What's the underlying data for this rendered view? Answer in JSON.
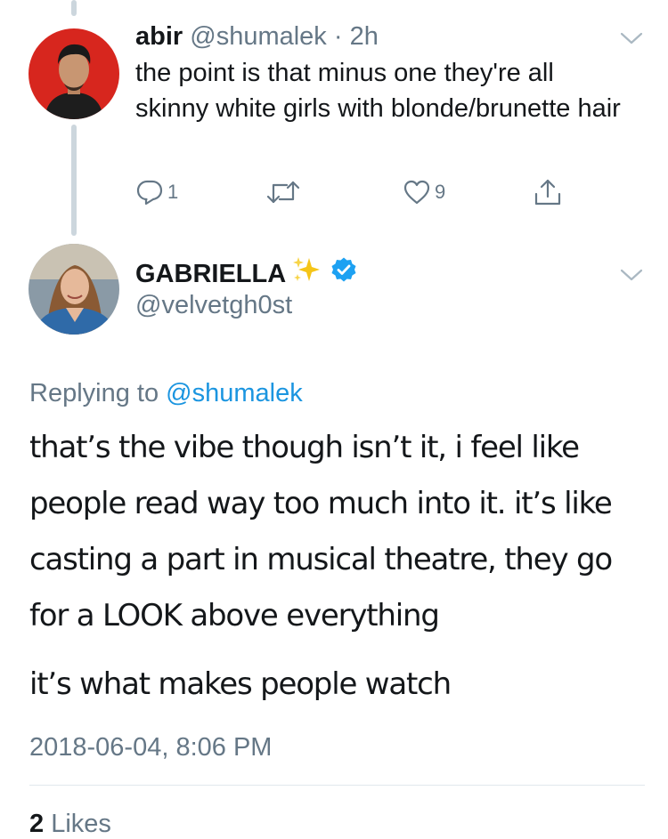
{
  "parent_tweet": {
    "display_name": "abir",
    "handle": "@shumalek",
    "separator": "·",
    "time_ago": "2h",
    "text": "the point is that minus one they're all skinny white girls with blonde/brunette hair",
    "replies": "1",
    "likes": "9",
    "avatar_bg": "#d7261e"
  },
  "main_tweet": {
    "display_name": "GABRIELLA",
    "handle": "@velvetgh0st",
    "replying_prefix": "Replying to",
    "replying_to": "@shumalek",
    "paragraphs": [
      "that’s the vibe though isn’t it, i feel like people read way too much into it. it’s like casting a part in musical theatre, they go for a LOOK above everything",
      "it’s what makes people watch"
    ],
    "timestamp": "2018-06-04, 8:06 PM",
    "likes_count": "2",
    "likes_label": "Likes"
  },
  "colors": {
    "text": "#14171a",
    "muted": "#657786",
    "link": "#1b95e0",
    "verified": "#1da1f2",
    "thread_line": "#ccd6dd",
    "sparkle": "#f5c518"
  },
  "icons": [
    "reply-icon",
    "retweet-icon",
    "like-icon",
    "share-icon",
    "caret-down-icon",
    "verified-badge-icon",
    "sparkles-emoji"
  ]
}
